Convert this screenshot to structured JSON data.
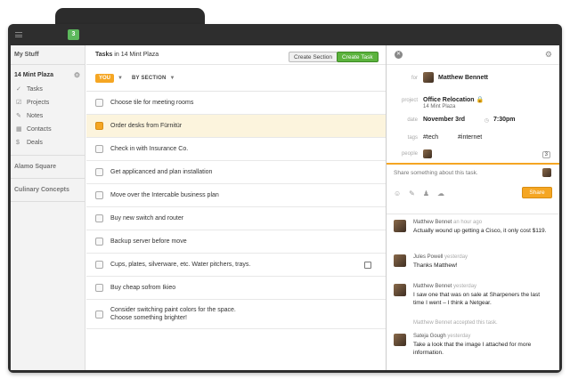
{
  "topbar": {
    "notification_count": "3"
  },
  "sidebar": {
    "header": "My Stuff",
    "project": "14 Mint Plaza",
    "items": [
      {
        "label": "Tasks",
        "icon": "check-icon"
      },
      {
        "label": "Projects",
        "icon": "checkbox-icon"
      },
      {
        "label": "Notes",
        "icon": "pin-icon"
      },
      {
        "label": "Contacts",
        "icon": "contacts-icon"
      },
      {
        "label": "Deals",
        "icon": "dollar-icon"
      }
    ],
    "groups": [
      "Alamo Square",
      "Culinary Concepts"
    ]
  },
  "main": {
    "title": "Tasks",
    "project": "in 14 Mint Plaza",
    "create_section": "Create Section",
    "create_task": "Create Task",
    "filter_you": "YOU",
    "filter_by": "BY SECTION",
    "tasks": [
      "Choose tile for meeting rooms",
      "Order desks from Fürnitür",
      "Check in with Insurance Co.",
      "Get applicanced and plan installation",
      "Move over the Intercable business plan",
      "Buy new switch and router",
      "Backup server before move",
      "Cups, plates, silverware, etc. Water pitchers, trays.",
      "Buy cheap sofrom Ikieo",
      "Consider switching paint colors for the space.\nChoose something brighter!"
    ]
  },
  "detail": {
    "labels": {
      "for": "for",
      "project": "project",
      "date": "date",
      "tags": "tags",
      "people": "people"
    },
    "assignee": "Matthew Bennett",
    "project_name": "Office Relocation",
    "project_sub": "14 Mint Plaza",
    "date": "November 3rd",
    "time": "7:30pm",
    "tag1": "#tech",
    "tag2": "#internet",
    "people_count": "3",
    "share_placeholder": "Share something about this task.",
    "share_button": "Share",
    "comments": [
      {
        "author": "Matthew Bennet",
        "time": "an hour ago",
        "text": "Actually wound up getting a Cisco, it only cost $119."
      },
      {
        "author": "Jules Powell",
        "time": "yesterday",
        "text": "Thanks Matthew!"
      },
      {
        "author": "Matthew Bennet",
        "time": "yesterday",
        "text": "I saw one that was on sale at Sharpeners the last time I went – I think a Netgear."
      },
      {
        "author": "Sateja Gough",
        "time": "yesterday",
        "text": "Take a look that the image I attached for more information."
      }
    ],
    "system_note": "Matthew Bennet accepted this task."
  }
}
